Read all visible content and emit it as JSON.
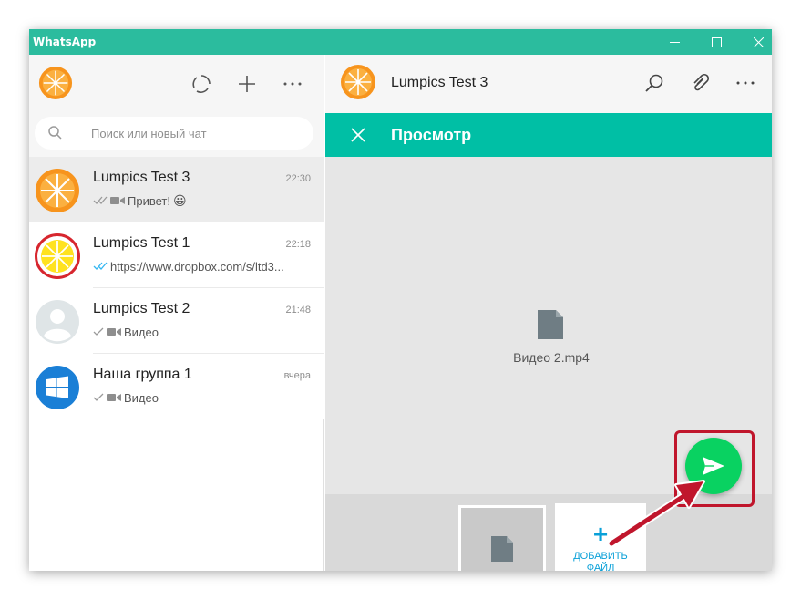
{
  "window": {
    "title": "WhatsApp"
  },
  "colors": {
    "titlebar": "#2bbc9e",
    "accent": "#00bfa5",
    "send": "#09d261",
    "add_file": "#09a0d8",
    "highlight": "#c0162c"
  },
  "sidebar": {
    "search_placeholder": "Поиск или новый чат",
    "chats": [
      {
        "name": "Lumpics Test 3",
        "time": "22:30",
        "preview": "Привет!",
        "status_icon": "double-check-icon",
        "media_icon": "video-icon",
        "emoji": "😀",
        "avatar": "orange-slice-avatar",
        "active": true
      },
      {
        "name": "Lumpics Test 1",
        "time": "22:18",
        "preview": "https://www.dropbox.com/s/ltd3...",
        "status_icon": "double-check-blue-icon",
        "avatar": "lemon-slice-avatar",
        "active": false
      },
      {
        "name": "Lumpics Test 2",
        "time": "21:48",
        "preview": "Видео",
        "status_icon": "check-icon",
        "media_icon": "video-icon",
        "avatar": "default-user-avatar",
        "active": false
      },
      {
        "name": "Наша группа 1",
        "time": "вчера",
        "preview": "Видео",
        "status_icon": "check-icon",
        "media_icon": "video-icon",
        "avatar": "windows-logo-avatar",
        "active": false
      }
    ]
  },
  "conversation": {
    "contact_name": "Lumpics Test 3"
  },
  "preview_panel": {
    "title": "Просмотр",
    "file_name": "Видео 2.mp4",
    "add_file_plus": "+",
    "add_file_label": "ДОБАВИТЬ ФАЙЛ"
  }
}
